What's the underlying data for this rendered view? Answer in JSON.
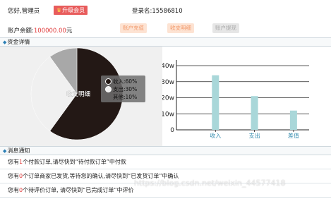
{
  "header": {
    "greeting": "您好,管理员",
    "upgrade_label": "升级会员",
    "login_label": "登录名:15586810",
    "balance_label": "账户余额:",
    "balance_value": "100000.00",
    "balance_unit": "元",
    "recharge_label": "账户充值",
    "detail_label": "收支明细",
    "records_label": "账户提现"
  },
  "funds": {
    "section_title": "资金详情"
  },
  "colors": {
    "income": "#231815",
    "expense": "#f0f0f0",
    "other": "#a8a8a8",
    "bar": "#a9d7d9"
  },
  "chart_data": [
    {
      "type": "pie",
      "center_label": "收支明细",
      "slices": [
        {
          "name": "收入",
          "value": 60,
          "label": "收入:60%"
        },
        {
          "name": "支出",
          "value": 30,
          "label": "支出:30%"
        },
        {
          "name": "其他",
          "value": 10,
          "label": "其他:10%"
        }
      ]
    },
    {
      "type": "bar",
      "categories": [
        "收入",
        "支出",
        "差值"
      ],
      "values": [
        34,
        21,
        12
      ],
      "ylim": [
        0,
        40
      ],
      "yticks": [
        "0",
        "10w",
        "20w",
        "30w",
        "40w"
      ],
      "grid": true
    }
  ],
  "messages": {
    "section_title": "消息通知",
    "rows": [
      {
        "pre": "您有",
        "num": "1",
        "post": "个付款订单,请尽快到“待付款订单”中付款"
      },
      {
        "pre": "您有",
        "num": "0",
        "post": "个订单商家已发货,等待您的确认,请尽快到“已发货订单”中确认"
      },
      {
        "pre": "您有",
        "num": "0",
        "post": "个待评价订单, 请尽快到“已完成订单”中评价"
      }
    ]
  },
  "watermark": "https://blog.csdn.net/weixin_44577418"
}
